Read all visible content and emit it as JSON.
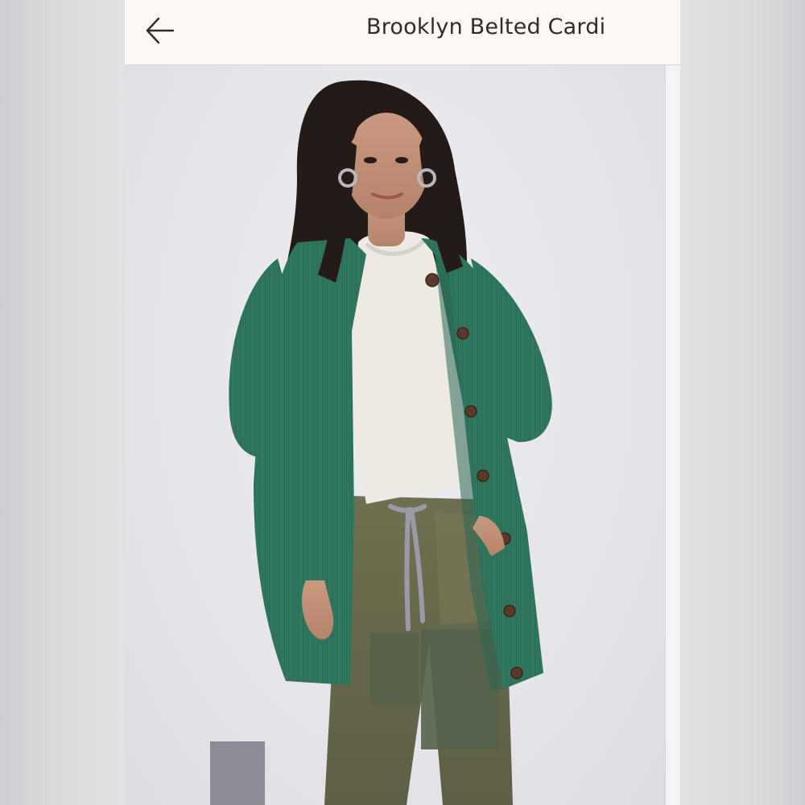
{
  "header": {
    "title": "Brooklyn Belted Cardi",
    "back_icon": "arrow-left-icon"
  },
  "product_image": {
    "alt": "Brooklyn Belted Cardi"
  },
  "colors": {
    "topbar_bg": "#fbf8f5",
    "cardigan_green": "#2f7a63",
    "pants_olive": "#6b6b4c",
    "shirt_white": "#efece6"
  }
}
